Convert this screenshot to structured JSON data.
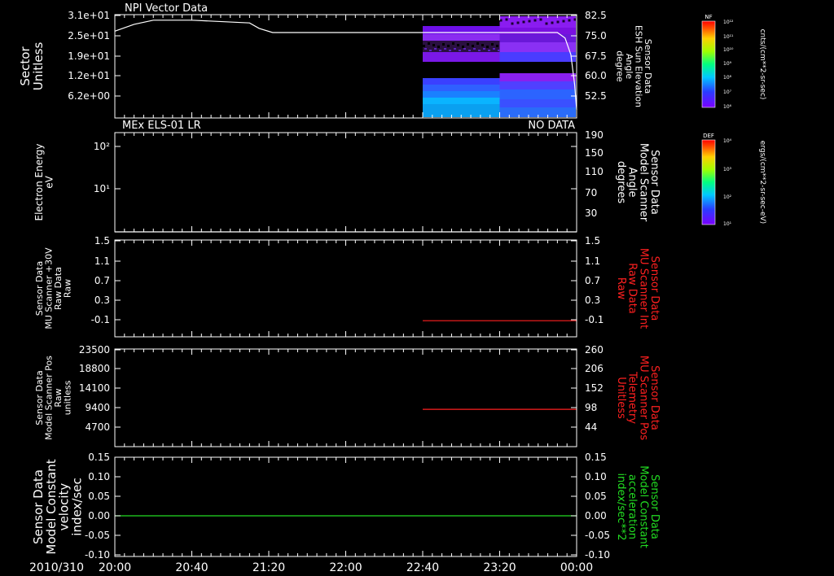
{
  "colors": {
    "background": "#000000",
    "axis": "#ffffff",
    "trace_white": "#ffffff",
    "trace_red": "#ff2020",
    "trace_green": "#22dd22",
    "label_red": "#ff2020",
    "label_green": "#22dd22"
  },
  "time_axis": {
    "date_label": "2010/310",
    "ticks": [
      "20:00",
      "20:40",
      "21:20",
      "22:00",
      "22:40",
      "23:20",
      "00:00"
    ],
    "range": [
      "20:00",
      "00:00"
    ]
  },
  "colorbars": [
    {
      "title": "NF",
      "units": "cnts/(cm**2-sr-sec)",
      "tick_labels": [
        "10¹²",
        "10¹¹",
        "10¹⁰",
        "10⁹",
        "10⁸",
        "10⁷",
        "10⁶"
      ]
    },
    {
      "title": "DEF",
      "units": "ergs/(cm**2-sr-sec-eV)",
      "tick_labels": [
        "10⁴",
        "10³",
        "10²",
        "10¹"
      ]
    }
  ],
  "chart_data": [
    {
      "type": "heatmap",
      "title": "NPI Vector Data",
      "ylabel": [
        "Sector",
        "Unitless"
      ],
      "yticks": [
        "3.1e+01",
        "2.5e+01",
        "1.9e+01",
        "1.2e+01",
        "6.2e+00"
      ],
      "right_ylabel": [
        "Sensor Data",
        "ESH Sun Elevation",
        "Angle",
        "degree"
      ],
      "right_yticks": [
        "82.5",
        "75.0",
        "67.5",
        "60.0",
        "52.5"
      ],
      "right_ylim": [
        45.0,
        82.5
      ],
      "line_series": {
        "name": "ESH Sun Elevation Angle",
        "x": [
          "20:00",
          "20:10",
          "20:20",
          "20:40",
          "21:10",
          "21:15",
          "21:22",
          "23:50",
          "23:54",
          "23:57",
          "23:59",
          "00:00"
        ],
        "values": [
          76.5,
          79.0,
          80.5,
          80.5,
          79.5,
          77.5,
          76.0,
          76.0,
          74.0,
          68.0,
          57.0,
          48.0
        ]
      },
      "spectrogram_extent": [
        "22:40",
        "00:00"
      ]
    },
    {
      "type": "line",
      "title": "MEx ELS-01 LR",
      "status_text": "NO DATA",
      "ylabel": [
        "Electron Energy",
        "eV"
      ],
      "yticks": [
        "10²",
        "10¹"
      ],
      "right_ylabel": [
        "Sensor Data",
        "Model Scanner",
        "Angle",
        "degrees"
      ],
      "right_yticks": [
        "190",
        "150",
        "110",
        "70",
        "30"
      ],
      "right_ylim": [
        10,
        190
      ],
      "series": [
        {
          "x": [
            "20:00",
            "00:00"
          ],
          "values": [
            10,
            10
          ]
        }
      ]
    },
    {
      "type": "line",
      "ylabel": [
        "Sensor Data",
        "MU Scanner +30V",
        "Raw Data",
        "Raw"
      ],
      "yticks": [
        "1.5",
        "1.1",
        "0.7",
        "0.3",
        "-0.1"
      ],
      "ylim": [
        -0.3,
        1.5
      ],
      "right_ylabel": [
        "Sensor Data",
        "MU Scanner Int",
        "Raw Data",
        "Raw"
      ],
      "right_yticks": [
        "1.5",
        "1.1",
        "0.7",
        "0.3",
        "-0.1"
      ],
      "series": [
        {
          "x": [
            "22:40",
            "00:00"
          ],
          "values": [
            0.0,
            0.0
          ]
        }
      ]
    },
    {
      "type": "line",
      "ylabel": [
        "Sensor Data",
        "Model Scanner Pos",
        "Raw",
        "unitless"
      ],
      "yticks": [
        "23500",
        "18800",
        "14100",
        "9400",
        "4700"
      ],
      "ylim": [
        0,
        23500
      ],
      "right_ylabel": [
        "Sensor Data",
        "MU Scanner Pos",
        "Telemetry",
        "Unitless"
      ],
      "right_yticks": [
        "260",
        "206",
        "152",
        "98",
        "44"
      ],
      "right_ylim": [
        0,
        260
      ],
      "series": [
        {
          "x": [
            "22:40",
            "00:00"
          ],
          "values": [
            8000,
            8000
          ]
        }
      ]
    },
    {
      "type": "line",
      "ylabel": [
        "Sensor Data",
        "Model Constant",
        "velocity",
        "index/sec"
      ],
      "yticks": [
        "0.15",
        "0.10",
        "0.05",
        "0.00",
        "-0.05",
        "-0.10"
      ],
      "ylim": [
        -0.1,
        0.15
      ],
      "right_ylabel": [
        "Sensor Data",
        "Model Constant",
        "acceleration",
        "index/sec**2"
      ],
      "right_yticks": [
        "0.15",
        "0.10",
        "0.05",
        "0.00",
        "-0.05",
        "-0.10"
      ],
      "series": [
        {
          "x": [
            "20:00",
            "00:00"
          ],
          "values": [
            0.0,
            0.0
          ]
        }
      ]
    }
  ]
}
